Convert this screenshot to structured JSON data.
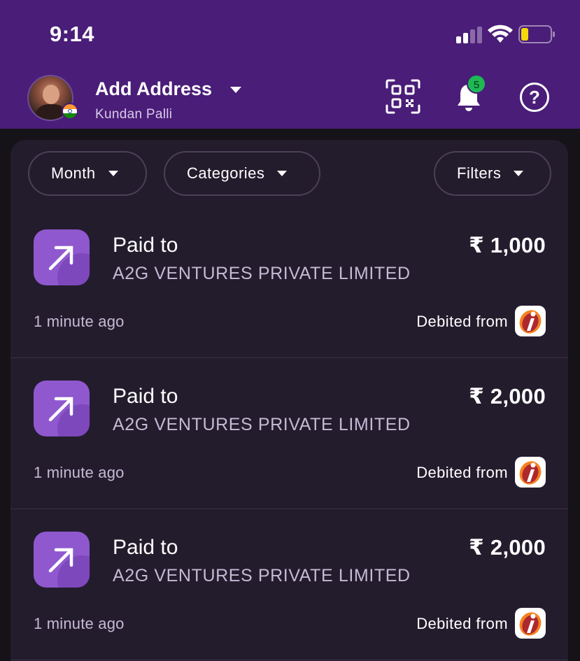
{
  "status_bar": {
    "time": "9:14"
  },
  "header": {
    "title": "Add Address",
    "subtitle": "Kundan Palli",
    "notification_count": "5",
    "help_glyph": "?",
    "bg_color": "#4a1d78"
  },
  "filters": [
    {
      "label": "Month"
    },
    {
      "label": "Categories"
    },
    {
      "label": "Filters"
    }
  ],
  "transactions": [
    {
      "title": "Paid to",
      "payee": "A2G VENTURES PRIVATE LIMITED",
      "amount": "₹ 1,000",
      "time": "1 minute ago",
      "debited_label": "Debited from",
      "bank_icon": "icici-bank-icon"
    },
    {
      "title": "Paid to",
      "payee": "A2G VENTURES PRIVATE LIMITED",
      "amount": "₹ 2,000",
      "time": "1 minute ago",
      "debited_label": "Debited from",
      "bank_icon": "icici-bank-icon"
    },
    {
      "title": "Paid to",
      "payee": "A2G VENTURES PRIVATE LIMITED",
      "amount": "₹ 2,000",
      "time": "1 minute ago",
      "debited_label": "Debited from",
      "bank_icon": "icici-bank-icon"
    }
  ],
  "colors": {
    "accent": "#8f58cf",
    "card_bg": "#231c2d",
    "badge": "#1db954",
    "battery_low": "#f5d90a"
  }
}
